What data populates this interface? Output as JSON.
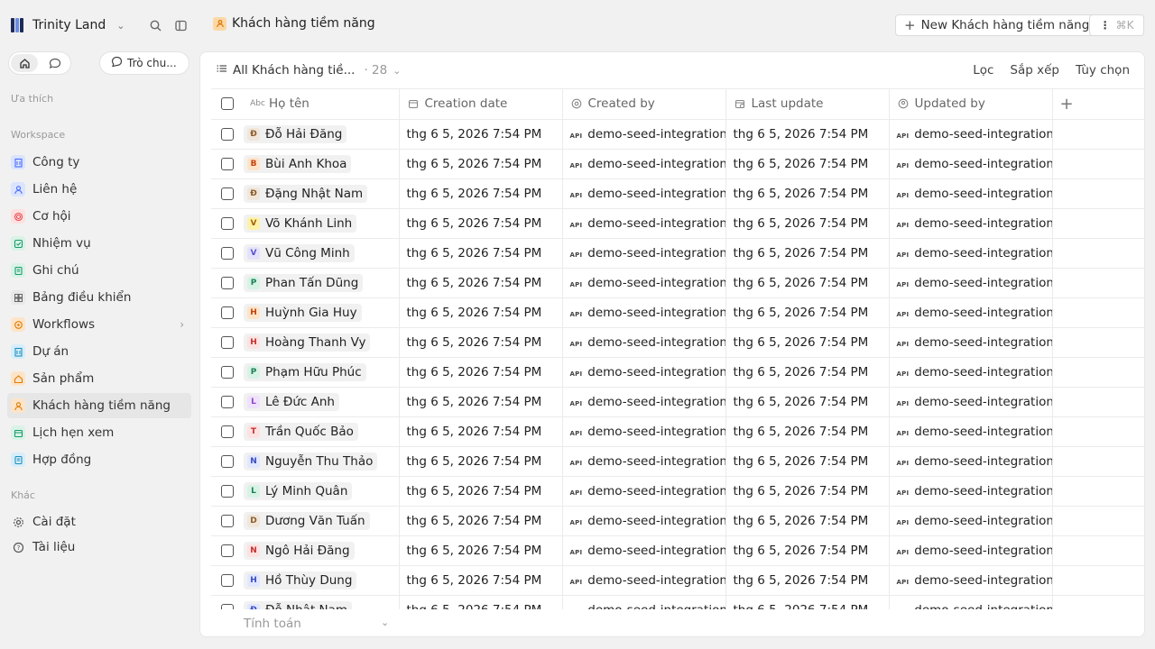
{
  "workspace": {
    "name": "Trinity Land"
  },
  "sidebar": {
    "ask_label": "Trò chu...",
    "favorites_label": "Ưa thích",
    "workspace_label": "Workspace",
    "other_label": "Khác",
    "items": [
      {
        "label": "Công ty",
        "icon": "building-icon",
        "color": "#4a6cf7",
        "bg": "#dbe4ff"
      },
      {
        "label": "Liên hệ",
        "icon": "person-icon",
        "color": "#4a6cf7",
        "bg": "#dbe4ff"
      },
      {
        "label": "Cơ hội",
        "icon": "target-icon",
        "color": "#e5484d",
        "bg": "#ffe0e0"
      },
      {
        "label": "Nhiệm vụ",
        "icon": "checkbox-icon",
        "color": "#1a9b6b",
        "bg": "#d8f3e6"
      },
      {
        "label": "Ghi chú",
        "icon": "note-icon",
        "color": "#1a9b6b",
        "bg": "#d8f3e6"
      },
      {
        "label": "Bảng điều khiển",
        "icon": "dashboard-icon",
        "color": "#666",
        "bg": "#e8e8e8"
      },
      {
        "label": "Workflows",
        "icon": "workflow-icon",
        "color": "#e07b00",
        "bg": "#fde4c8"
      },
      {
        "label": "Dự án",
        "icon": "building-icon",
        "color": "#1f8fbf",
        "bg": "#d6eefa"
      },
      {
        "label": "Sản phẩm",
        "icon": "home-icon",
        "color": "#e07b00",
        "bg": "#fde4c8"
      },
      {
        "label": "Khách hàng tiềm năng",
        "icon": "person-icon",
        "color": "#e07b00",
        "bg": "#fde4c8"
      },
      {
        "label": "Lịch hẹn xem",
        "icon": "calendar-icon",
        "color": "#1a9b6b",
        "bg": "#d8f3e6"
      },
      {
        "label": "Hợp đồng",
        "icon": "document-icon",
        "color": "#1f8fbf",
        "bg": "#d6eefa"
      }
    ],
    "other_items": [
      {
        "label": "Cài đặt",
        "icon": "gear-icon"
      },
      {
        "label": "Tài liệu",
        "icon": "help-icon"
      }
    ]
  },
  "header": {
    "title": "Khách hàng tiềm năng",
    "new_button": "New Khách hàng tiềm năng",
    "shortcut": "⌘K"
  },
  "view": {
    "name": "All Khách hàng tiề...",
    "count": "· 28",
    "filter": "Lọc",
    "sort": "Sắp xếp",
    "options": "Tùy chọn"
  },
  "table": {
    "columns": [
      "Họ tên",
      "Creation date",
      "Created by",
      "Last update",
      "Updated by"
    ],
    "rows": [
      {
        "initial": "Đ",
        "name": "Đỗ Hải Đăng",
        "avbg": "#f0e6da",
        "avfg": "#8a5a2b"
      },
      {
        "initial": "B",
        "name": "Bùi Anh Khoa",
        "avbg": "#fde4c8",
        "avfg": "#c2410c"
      },
      {
        "initial": "Đ",
        "name": "Đặng Nhật Nam",
        "avbg": "#f0e6da",
        "avfg": "#8a5a2b"
      },
      {
        "initial": "V",
        "name": "Võ Khánh Linh",
        "avbg": "#fdf3a8",
        "avfg": "#a16207"
      },
      {
        "initial": "V",
        "name": "Vũ Công Minh",
        "avbg": "#e4e2fb",
        "avfg": "#5b52c9"
      },
      {
        "initial": "P",
        "name": "Phan Tấn Dũng",
        "avbg": "#d8f3e6",
        "avfg": "#1a7f57"
      },
      {
        "initial": "H",
        "name": "Huỳnh Gia Huy",
        "avbg": "#fde4c8",
        "avfg": "#c2410c"
      },
      {
        "initial": "H",
        "name": "Hoàng Thanh Vy",
        "avbg": "#fde2e2",
        "avfg": "#c53030"
      },
      {
        "initial": "P",
        "name": "Phạm Hữu Phúc",
        "avbg": "#d8f3e6",
        "avfg": "#1a7f57"
      },
      {
        "initial": "L",
        "name": "Lê Đức Anh",
        "avbg": "#efe2fb",
        "avfg": "#8e44c9"
      },
      {
        "initial": "T",
        "name": "Trần Quốc Bảo",
        "avbg": "#fde2e2",
        "avfg": "#c53030"
      },
      {
        "initial": "N",
        "name": "Nguyễn Thu Thảo",
        "avbg": "#e0e7ff",
        "avfg": "#3b4cc0"
      },
      {
        "initial": "L",
        "name": "Lý Minh Quân",
        "avbg": "#d8f3e6",
        "avfg": "#1a7f57"
      },
      {
        "initial": "D",
        "name": "Dương Văn Tuấn",
        "avbg": "#f0e6da",
        "avfg": "#8a5a2b"
      },
      {
        "initial": "N",
        "name": "Ngô Hải Đăng",
        "avbg": "#fde2e2",
        "avfg": "#c53030"
      },
      {
        "initial": "H",
        "name": "Hồ Thùy Dung",
        "avbg": "#e0e7ff",
        "avfg": "#3b4cc0"
      },
      {
        "initial": "Đ",
        "name": "Đỗ Nhật Nam",
        "avbg": "#e0e7ff",
        "avfg": "#3b4cc0"
      }
    ],
    "date_value": "thg 6 5, 2026 7:54 PM",
    "user_value": "demo-seed-integration",
    "api_badge": "API"
  },
  "footer": {
    "calc_label": "Tính toán"
  }
}
